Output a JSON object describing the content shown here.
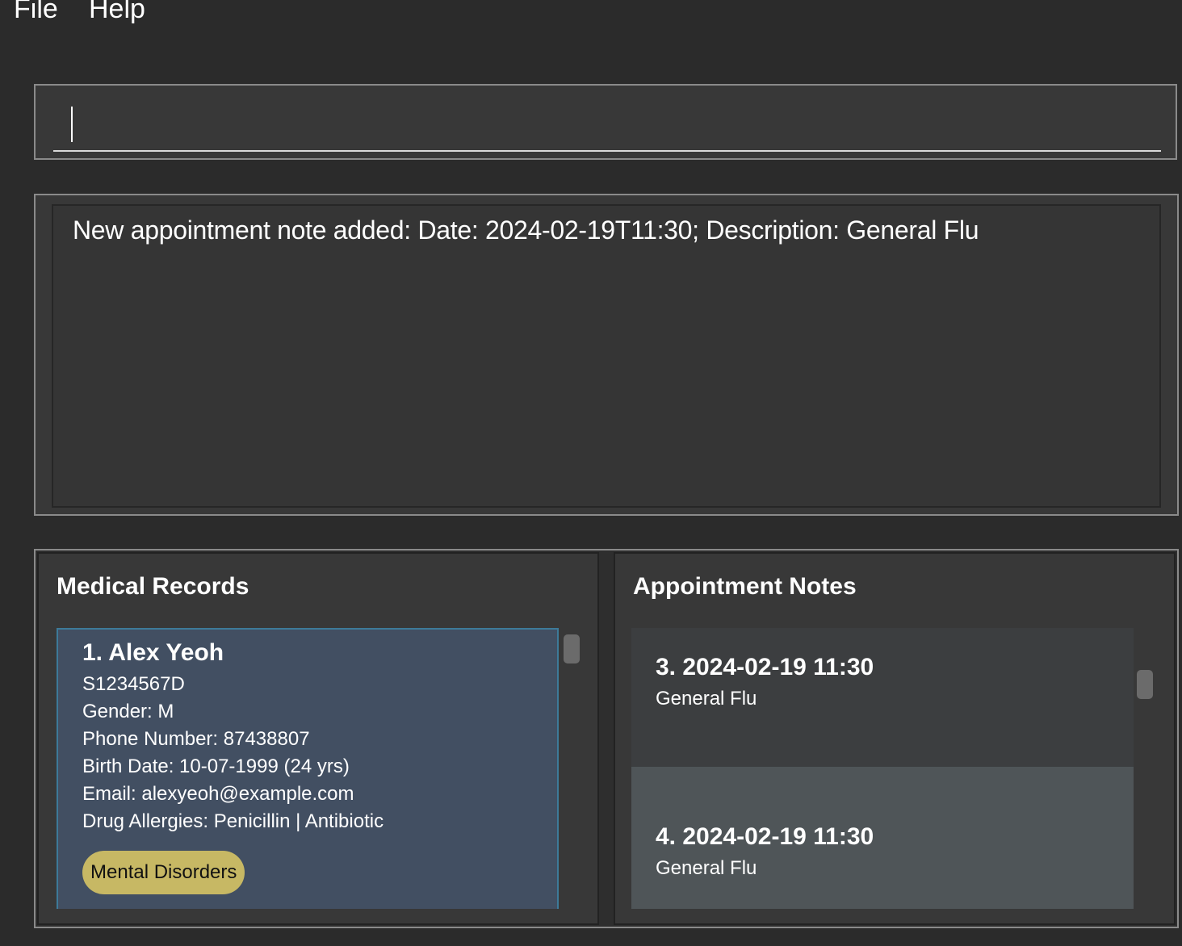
{
  "menu": {
    "file": "File",
    "help": "Help"
  },
  "command": {
    "value": "",
    "placeholder": ""
  },
  "result": {
    "message": "New appointment note added:  Date: 2024-02-19T11:30; Description: General Flu"
  },
  "records": {
    "title": "Medical Records",
    "items": [
      {
        "index": "1.",
        "name": "Alex Yeoh",
        "heading": "1.  Alex Yeoh",
        "nric": "S1234567D",
        "gender": "Gender: M",
        "phone": "Phone Number: 87438807",
        "birth": "Birth Date: 10-07-1999 (24 yrs)",
        "email": "Email: alexyeoh@example.com",
        "allergies": "Drug Allergies: Penicillin | Antibiotic",
        "tags": [
          "Mental Disorders"
        ]
      }
    ]
  },
  "notes": {
    "title": "Appointment Notes",
    "items": [
      {
        "heading": "3.  2024-02-19 11:30",
        "description": "General Flu"
      },
      {
        "heading": "4.  2024-02-19 11:30",
        "description": "General Flu"
      }
    ]
  },
  "colors": {
    "background": "#2b2b2b",
    "panel": "#383838",
    "selected_card": "#424f62",
    "selected_border": "#3d7a99",
    "tag": "#c7b864",
    "note_alt": "#4f5558"
  }
}
